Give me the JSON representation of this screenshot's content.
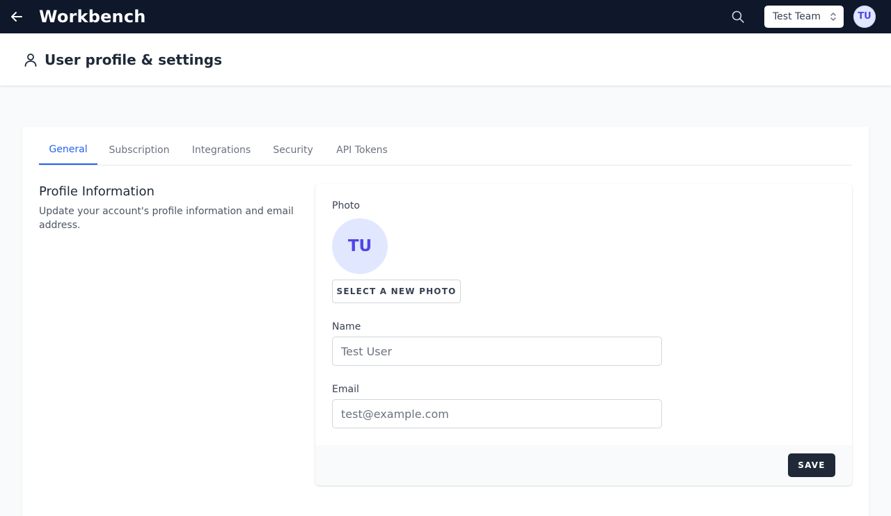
{
  "topbar": {
    "title": "Workbench",
    "back_icon": "arrow-left-icon",
    "search_icon": "search-icon",
    "team_select": {
      "value": "Test Team",
      "icon": "chevron-up-down-icon"
    },
    "avatar_initials": "TU",
    "background": "#0f172a"
  },
  "page_header": {
    "icon": "user-icon",
    "title": "User profile & settings"
  },
  "tabs": [
    {
      "label": "General",
      "active": true
    },
    {
      "label": "Subscription",
      "active": false
    },
    {
      "label": "Integrations",
      "active": false
    },
    {
      "label": "Security",
      "active": false
    },
    {
      "label": "API Tokens",
      "active": false
    }
  ],
  "profile": {
    "title": "Profile Information",
    "description": "Update your account's profile information and email address.",
    "photo_label": "Photo",
    "photo_initials": "TU",
    "select_photo_label": "SELECT A NEW PHOTO",
    "name_label": "Name",
    "name_value": "Test User",
    "email_label": "Email",
    "email_value": "test@example.com",
    "save_label": "SAVE"
  },
  "colors": {
    "accent": "#2563eb",
    "avatar_bg": "#e0e7ff",
    "avatar_text": "#4f46e5",
    "button_dark": "#1f2937"
  }
}
